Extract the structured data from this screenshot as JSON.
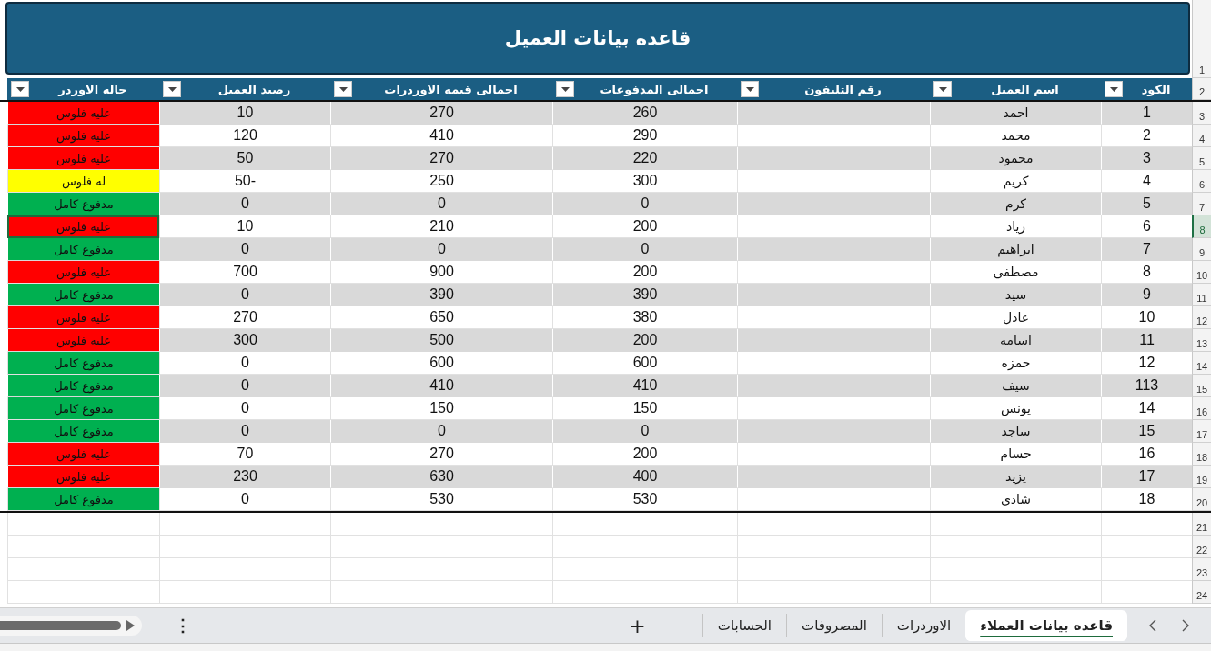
{
  "sheet": {
    "title": "قاعده بيانات العميل",
    "columns": [
      "الكود",
      "اسم العميل",
      "رقم التليفون",
      "اجمالى المدفوعات",
      "اجمالى قيمه الاوردرات",
      "رصيد العميل",
      "حاله الاوردر"
    ],
    "rows": [
      {
        "code": "1",
        "name": "احمد",
        "paid": "260",
        "total": "270",
        "balance": "10",
        "status": "عليه فلوس",
        "color": "#ff0000",
        "selected": false
      },
      {
        "code": "2",
        "name": "محمد",
        "paid": "290",
        "total": "410",
        "balance": "120",
        "status": "عليه فلوس",
        "color": "#ff0000",
        "selected": false
      },
      {
        "code": "3",
        "name": "محمود",
        "paid": "220",
        "total": "270",
        "balance": "50",
        "status": "عليه فلوس",
        "color": "#ff0000",
        "selected": false
      },
      {
        "code": "4",
        "name": "كريم",
        "paid": "300",
        "total": "250",
        "balance": "-50",
        "status": "له فلوس",
        "color": "#ffff00",
        "selected": false
      },
      {
        "code": "5",
        "name": "كرم",
        "paid": "0",
        "total": "0",
        "balance": "0",
        "status": "مدفوع كامل",
        "color": "#00b050",
        "selected": false
      },
      {
        "code": "6",
        "name": "زياد",
        "paid": "200",
        "total": "210",
        "balance": "10",
        "status": "عليه فلوس",
        "color": "#ff0000",
        "selected": true
      },
      {
        "code": "7",
        "name": "ابراهيم",
        "paid": "0",
        "total": "0",
        "balance": "0",
        "status": "مدفوع كامل",
        "color": "#00b050",
        "selected": false
      },
      {
        "code": "8",
        "name": "مصطفى",
        "paid": "200",
        "total": "900",
        "balance": "700",
        "status": "عليه فلوس",
        "color": "#ff0000",
        "selected": false
      },
      {
        "code": "9",
        "name": "سيد",
        "paid": "390",
        "total": "390",
        "balance": "0",
        "status": "مدفوع كامل",
        "color": "#00b050",
        "selected": false
      },
      {
        "code": "10",
        "name": "عادل",
        "paid": "380",
        "total": "650",
        "balance": "270",
        "status": "عليه فلوس",
        "color": "#ff0000",
        "selected": false
      },
      {
        "code": "11",
        "name": "اسامه",
        "paid": "200",
        "total": "500",
        "balance": "300",
        "status": "عليه فلوس",
        "color": "#ff0000",
        "selected": false
      },
      {
        "code": "12",
        "name": "حمزه",
        "paid": "600",
        "total": "600",
        "balance": "0",
        "status": "مدفوع كامل",
        "color": "#00b050",
        "selected": false
      },
      {
        "code": "113",
        "name": "سيف",
        "paid": "410",
        "total": "410",
        "balance": "0",
        "status": "مدفوع كامل",
        "color": "#00b050",
        "selected": false
      },
      {
        "code": "14",
        "name": "يونس",
        "paid": "150",
        "total": "150",
        "balance": "0",
        "status": "مدفوع كامل",
        "color": "#00b050",
        "selected": false
      },
      {
        "code": "15",
        "name": "ساجد",
        "paid": "0",
        "total": "0",
        "balance": "0",
        "status": "مدفوع كامل",
        "color": "#00b050",
        "selected": false
      },
      {
        "code": "16",
        "name": "حسام",
        "paid": "200",
        "total": "270",
        "balance": "70",
        "status": "عليه فلوس",
        "color": "#ff0000",
        "selected": false
      },
      {
        "code": "17",
        "name": "يزيد",
        "paid": "400",
        "total": "630",
        "balance": "230",
        "status": "عليه فلوس",
        "color": "#ff0000",
        "selected": false
      },
      {
        "code": "18",
        "name": "شادى",
        "paid": "530",
        "total": "530",
        "balance": "0",
        "status": "مدفوع كامل",
        "color": "#00b050",
        "selected": false
      }
    ],
    "row_numbers": [
      {
        "label": "1",
        "selected": false
      },
      {
        "label": "2",
        "selected": false
      },
      {
        "label": "3",
        "selected": false
      },
      {
        "label": "4",
        "selected": false
      },
      {
        "label": "5",
        "selected": false
      },
      {
        "label": "6",
        "selected": false
      },
      {
        "label": "7",
        "selected": false
      },
      {
        "label": "8",
        "selected": true
      },
      {
        "label": "9",
        "selected": false
      },
      {
        "label": "10",
        "selected": false
      },
      {
        "label": "11",
        "selected": false
      },
      {
        "label": "12",
        "selected": false
      },
      {
        "label": "13",
        "selected": false
      },
      {
        "label": "14",
        "selected": false
      },
      {
        "label": "15",
        "selected": false
      },
      {
        "label": "16",
        "selected": false
      },
      {
        "label": "17",
        "selected": false
      },
      {
        "label": "18",
        "selected": false
      },
      {
        "label": "19",
        "selected": false
      },
      {
        "label": "20",
        "selected": false
      },
      {
        "label": "21",
        "selected": false
      },
      {
        "label": "22",
        "selected": false
      },
      {
        "label": "23",
        "selected": false
      },
      {
        "label": "24",
        "selected": false
      }
    ]
  },
  "sheet_tabs": [
    {
      "label": "قاعده بيانات العملاء",
      "selected": true
    },
    {
      "label": "الاوردرات",
      "selected": false
    },
    {
      "label": "المصروفات",
      "selected": false
    },
    {
      "label": "الحسابات",
      "selected": false
    }
  ],
  "add_sheet": "+",
  "more_menu": "⋮"
}
